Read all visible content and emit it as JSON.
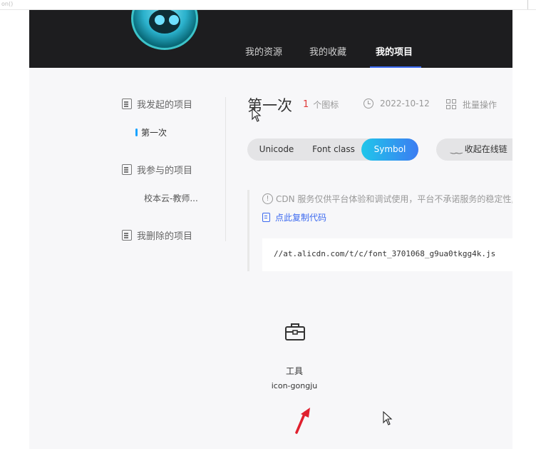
{
  "browser": {
    "corner_text": "on()"
  },
  "header": {
    "tabs": [
      {
        "label": "我的资源",
        "active": false
      },
      {
        "label": "我的收藏",
        "active": false
      },
      {
        "label": "我的项目",
        "active": true
      }
    ]
  },
  "sidebar": {
    "groups": [
      {
        "label": "我发起的项目",
        "icon": "edit-list-icon",
        "items": [
          {
            "label": "第一次",
            "active": true
          }
        ]
      },
      {
        "label": "我参与的项目",
        "icon": "shared-list-icon",
        "items": [
          {
            "label": "校本云-教师...",
            "active": false
          }
        ]
      },
      {
        "label": "我删除的项目",
        "icon": "deleted-list-icon",
        "items": []
      }
    ]
  },
  "project": {
    "title": "第一次",
    "icon_count": "1",
    "icon_count_unit": "个图标",
    "date": "2022-10-12",
    "batch_action": "批量操作"
  },
  "format_tabs": [
    {
      "label": "Unicode",
      "active": false
    },
    {
      "label": "Font class",
      "active": false
    },
    {
      "label": "Symbol",
      "active": true
    }
  ],
  "collapse_online": "收起在线链",
  "notice": "CDN 服务仅供平台体验和调试使用，平台不承诺服务的稳定性,",
  "copy_code": "点此复制代码",
  "code_url": "//at.alicdn.com/t/c/font_3701068_g9ua0tkgg4k.js",
  "icons": [
    {
      "name": "工具",
      "code": "icon-gongju",
      "icon": "toolbox-icon"
    }
  ],
  "colors": {
    "accent": "#3c6af0",
    "count": "#e03a3a",
    "header_bg": "#1d1d1f",
    "active_gradient": [
      "#1fc6ea",
      "#3c7cf2"
    ],
    "annotation_arrow": "#e0202e"
  }
}
